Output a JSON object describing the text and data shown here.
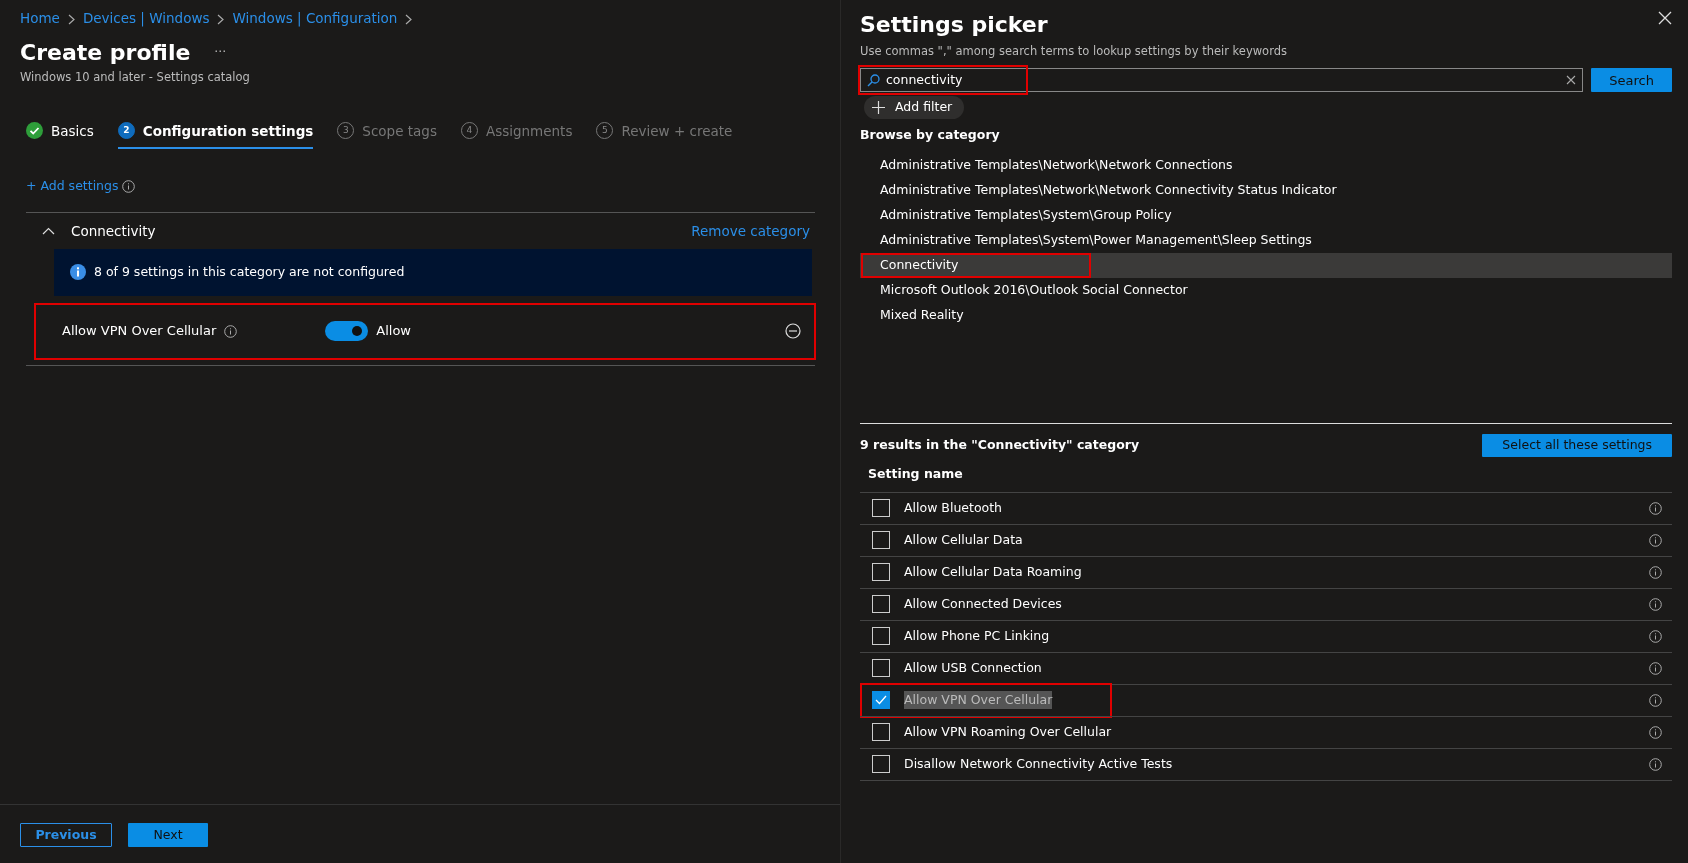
{
  "breadcrumb": [
    "Home",
    "Devices | Windows",
    "Windows | Configuration"
  ],
  "page": {
    "title": "Create profile",
    "more": "···",
    "subtitle": "Windows 10 and later - Settings catalog"
  },
  "steps": [
    {
      "label": "Basics",
      "kind": "done",
      "selected": false
    },
    {
      "number": "2",
      "label": "Configuration settings",
      "kind": "current",
      "selected": true
    },
    {
      "number": "3",
      "label": "Scope tags",
      "kind": "pending",
      "selected": false
    },
    {
      "number": "4",
      "label": "Assignments",
      "kind": "pending",
      "selected": false
    },
    {
      "number": "5",
      "label": "Review + create",
      "kind": "pending",
      "selected": false
    }
  ],
  "add_settings": "+ Add settings",
  "category": {
    "name": "Connectivity",
    "expanded": true,
    "remove": "Remove category",
    "banner": "8 of 9 settings in this category are not configured",
    "settings": [
      {
        "name": "Allow VPN Over Cellular",
        "on": true,
        "value": "Allow",
        "highlighted": true
      }
    ]
  },
  "footer": {
    "buttons": [
      {
        "label": "Previous",
        "kind": "outline"
      },
      {
        "label": "Next",
        "kind": "primary"
      }
    ]
  },
  "picker": {
    "title": "Settings picker",
    "hint": "Use commas \",\" among search terms to lookup settings by their keywords",
    "search": {
      "value": "connectivity",
      "highlighted": true
    },
    "search_button": "Search",
    "add_filter": "Add filter",
    "browse_heading": "Browse by category",
    "categories": [
      {
        "label": "Administrative Templates\\Network\\Network Connections",
        "selected": false,
        "highlighted": false
      },
      {
        "label": "Administrative Templates\\Network\\Network Connectivity Status Indicator",
        "selected": false,
        "highlighted": false
      },
      {
        "label": "Administrative Templates\\System\\Group Policy",
        "selected": false,
        "highlighted": false
      },
      {
        "label": "Administrative Templates\\System\\Power Management\\Sleep Settings",
        "selected": false,
        "highlighted": false
      },
      {
        "label": "Connectivity",
        "selected": true,
        "highlighted": true
      },
      {
        "label": "Microsoft Outlook 2016\\Outlook Social Connector",
        "selected": false,
        "highlighted": false
      },
      {
        "label": "Mixed Reality",
        "selected": false,
        "highlighted": false
      }
    ],
    "results_heading": "9 results in the \"Connectivity\" category",
    "select_all": "Select all these settings",
    "column": "Setting name",
    "results": [
      {
        "name": "Allow Bluetooth",
        "checked": false,
        "highlighted": false
      },
      {
        "name": "Allow Cellular Data",
        "checked": false,
        "highlighted": false
      },
      {
        "name": "Allow Cellular Data Roaming",
        "checked": false,
        "highlighted": false
      },
      {
        "name": "Allow Connected Devices",
        "checked": false,
        "highlighted": false
      },
      {
        "name": "Allow Phone PC Linking",
        "checked": false,
        "highlighted": false
      },
      {
        "name": "Allow USB Connection",
        "checked": false,
        "highlighted": false
      },
      {
        "name": "Allow VPN Over Cellular",
        "checked": true,
        "highlighted": true
      },
      {
        "name": "Allow VPN Roaming Over Cellular",
        "checked": false,
        "highlighted": false
      },
      {
        "name": "Disallow Network Connectivity Active Tests",
        "checked": false,
        "highlighted": false
      }
    ]
  }
}
